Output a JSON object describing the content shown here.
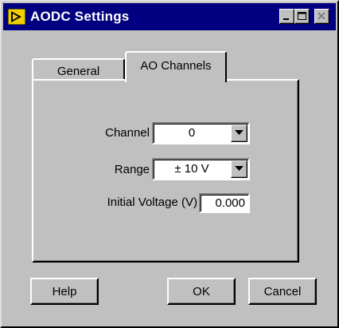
{
  "window": {
    "title": "AODC Settings",
    "icons": {
      "app": "labview-app-icon",
      "minimize": "minimize-icon",
      "maximize": "maximize-icon",
      "close": "close-icon"
    }
  },
  "tabs": [
    {
      "label": "General",
      "active": false
    },
    {
      "label": "AO Channels",
      "active": true
    }
  ],
  "form": {
    "channel": {
      "label": "Channel",
      "value": "0"
    },
    "range": {
      "label": "Range",
      "value": "± 10 V"
    },
    "initial_voltage": {
      "label": "Initial Voltage (V)",
      "value": "0.000"
    }
  },
  "buttons": {
    "help": "Help",
    "ok": "OK",
    "cancel": "Cancel"
  },
  "colors": {
    "face": "#c0c0c0",
    "titlebar": "#000080"
  }
}
